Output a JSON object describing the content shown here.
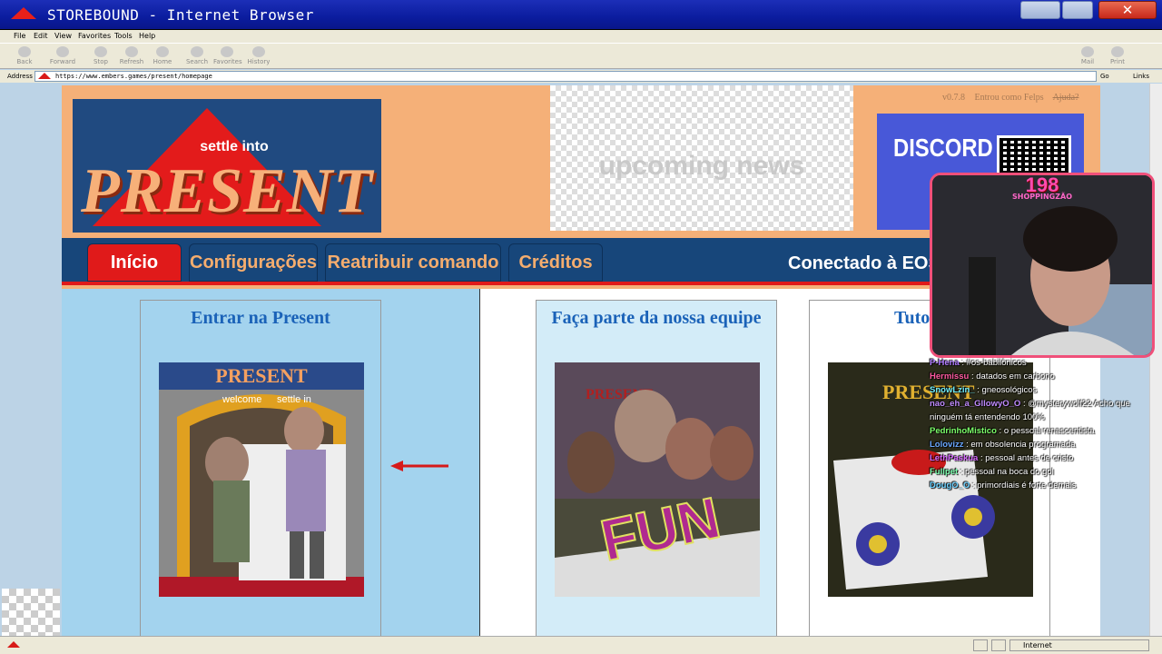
{
  "window": {
    "title": "STOREBOUND - Internet Browser",
    "close_label": "✕"
  },
  "menu": [
    "File",
    "Edit",
    "View",
    "Favorites",
    "Tools",
    "Help"
  ],
  "toolbar": {
    "back": "Back",
    "forward": "Forward",
    "stop": "Stop",
    "refresh": "Refresh",
    "home": "Home",
    "search": "Search",
    "favorites": "Favorites",
    "history": "History",
    "mail": "Mail",
    "print": "Print"
  },
  "address": {
    "label": "Address",
    "url": "https://www.embers.games/present/homepage",
    "go": "Go",
    "links": "Links"
  },
  "header": {
    "logo_small": "settle into",
    "logo_big": "PRESENT",
    "news_text": "upcoming news",
    "version": "v0.7.8",
    "logged_in": "Entrou como Felps",
    "help": "Ajuda?",
    "discord_label": "DISCORD"
  },
  "nav": {
    "tabs": [
      "Início",
      "Configurações",
      "Reatribuir comando",
      "Créditos"
    ],
    "active": 0,
    "status": "Conectado à EOS"
  },
  "cards": [
    {
      "title": "Entrar na Present",
      "img_text_top": "PRESENT",
      "img_text_a": "welcome",
      "img_text_b": "settle in"
    },
    {
      "title": "Faça parte da nossa equipe",
      "img_text_top": "PRESENT",
      "img_text_big": "FUN"
    },
    {
      "title": "Tuto",
      "img_text_top": "PRESENT"
    }
  ],
  "webcam": {
    "count": "198",
    "label": "SHOPPINGZÃO"
  },
  "chat": [
    {
      "user": "P-Hena",
      "text": ": #os-babilônicos",
      "color": "#b07cff"
    },
    {
      "user": "Hermissu",
      "text": ": datados em carbono",
      "color": "#ff5aa0"
    },
    {
      "user": "SnowLzin_",
      "text": ": gneosológicos",
      "color": "#6ef0ff"
    },
    {
      "user": "nao_eh_a_GllowyO_O",
      "text": ": @mysterywolf22 Acho que ninguém tá entendendo 100%",
      "color": "#c08bff"
    },
    {
      "user": "PedrinhoMistico",
      "text": ": o pessoal renascentista",
      "color": "#7dff6a"
    },
    {
      "user": "Lolovizz",
      "text": ": em obsolencia programada",
      "color": "#6aa8ff"
    },
    {
      "user": "LethPaskua",
      "text": ": pessoal antes de cristo",
      "color": "#d86aff"
    },
    {
      "user": "Fullpet",
      "text": ": pessoal na boca do gol",
      "color": "#7dffb0"
    },
    {
      "user": "DougO_O",
      "text": ": primordiais é forte demais",
      "color": "#6ad0ff"
    }
  ],
  "status": {
    "zone": "Internet"
  }
}
